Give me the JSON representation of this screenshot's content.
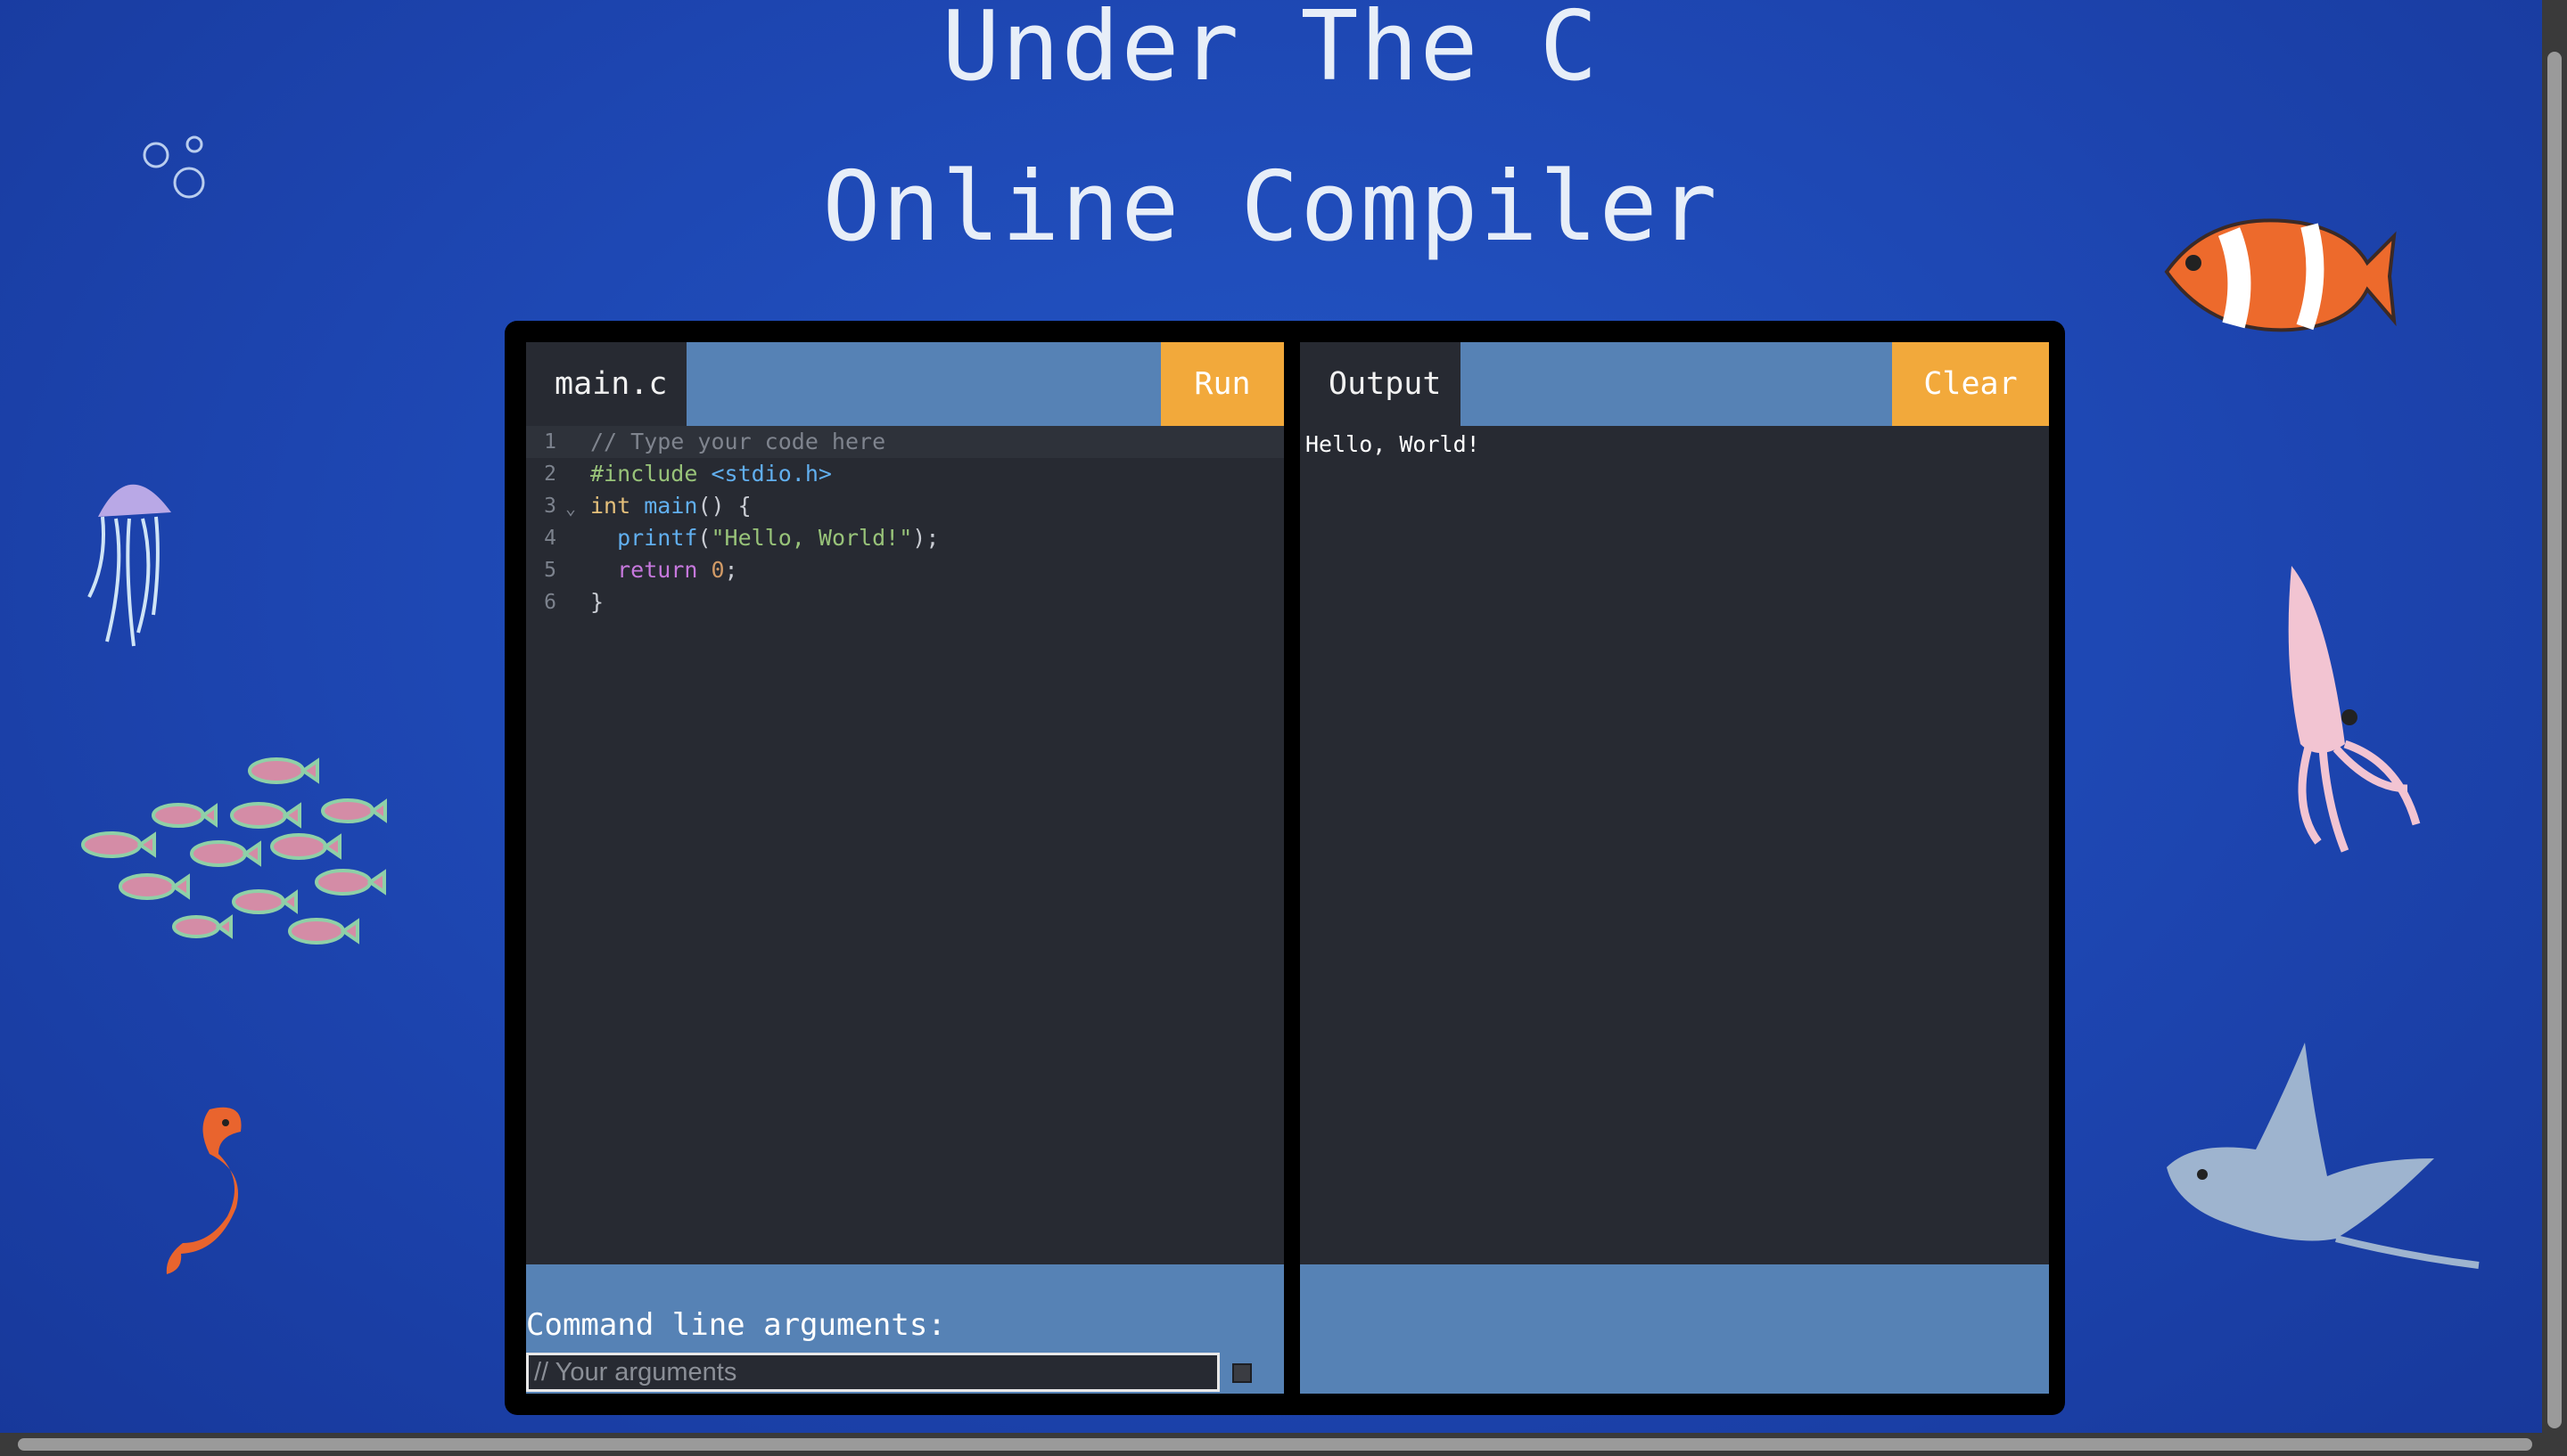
{
  "title": {
    "line1": "Under The C",
    "line2": "Online Compiler"
  },
  "editor": {
    "tab_label": "main.c",
    "run_label": "Run",
    "lines": [
      {
        "num": "1",
        "parts": [
          {
            "t": "// Type your code here",
            "c": "c-cm"
          }
        ],
        "active": true,
        "fold": ""
      },
      {
        "num": "2",
        "parts": [
          {
            "t": "#include ",
            "c": "c-inc"
          },
          {
            "t": "<stdio.h>",
            "c": "c-hdr"
          }
        ],
        "active": false,
        "fold": ""
      },
      {
        "num": "3",
        "parts": [
          {
            "t": "int",
            "c": "c-kw"
          },
          {
            "t": " ",
            "c": "c-p"
          },
          {
            "t": "main",
            "c": "c-fn"
          },
          {
            "t": "() {",
            "c": "c-p"
          }
        ],
        "active": false,
        "fold": "⌄"
      },
      {
        "num": "4",
        "parts": [
          {
            "t": "  ",
            "c": "c-p"
          },
          {
            "t": "printf",
            "c": "c-fn"
          },
          {
            "t": "(",
            "c": "c-p"
          },
          {
            "t": "\"Hello, World!\"",
            "c": "c-str"
          },
          {
            "t": ");",
            "c": "c-p"
          }
        ],
        "active": false,
        "fold": ""
      },
      {
        "num": "5",
        "parts": [
          {
            "t": "  ",
            "c": "c-p"
          },
          {
            "t": "return",
            "c": "c-ret"
          },
          {
            "t": " ",
            "c": "c-p"
          },
          {
            "t": "0",
            "c": "c-num"
          },
          {
            "t": ";",
            "c": "c-p"
          }
        ],
        "active": false,
        "fold": ""
      },
      {
        "num": "6",
        "parts": [
          {
            "t": "}",
            "c": "c-p"
          }
        ],
        "active": false,
        "fold": ""
      }
    ],
    "args_label": "Command line arguments:",
    "args_placeholder": "// Your arguments",
    "args_value": ""
  },
  "output": {
    "tab_label": "Output",
    "clear_label": "Clear",
    "text": "Hello, World!"
  },
  "colors": {
    "accent": "#f2a93b",
    "bar": "#5682b5",
    "panel": "#272a32",
    "background": "#1d45b0"
  },
  "decorations": [
    "bubbles",
    "jellyfish",
    "fish-school",
    "seahorse",
    "clownfish",
    "squid",
    "stingray"
  ]
}
